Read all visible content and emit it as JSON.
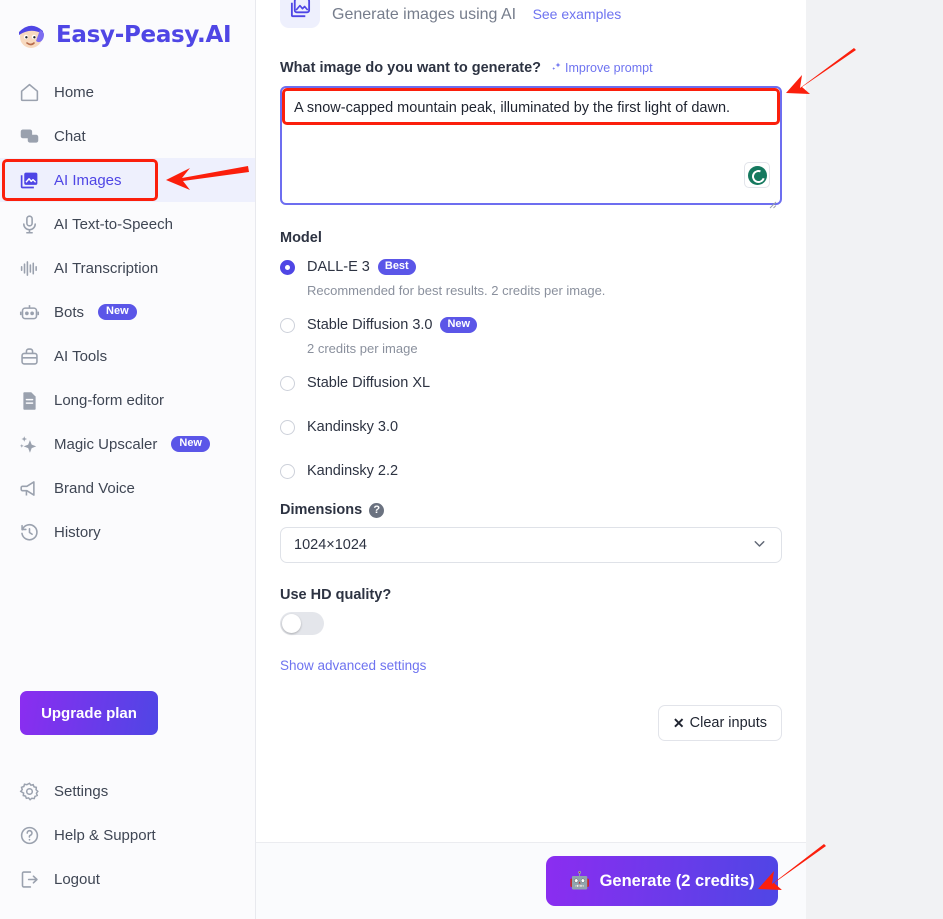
{
  "brand": {
    "name": "Easy-Peasy.AI",
    "mascot_icon": "mascot-avatar-icon"
  },
  "sidebar": {
    "items": [
      {
        "label": "Home",
        "icon": "home-icon",
        "badge": null,
        "active": false
      },
      {
        "label": "Chat",
        "icon": "chat-bubble-icon",
        "badge": null,
        "active": false
      },
      {
        "label": "AI Images",
        "icon": "image-icon",
        "badge": null,
        "active": true
      },
      {
        "label": "AI Text-to-Speech",
        "icon": "microphone-icon",
        "badge": null,
        "active": false
      },
      {
        "label": "AI Transcription",
        "icon": "waveform-icon",
        "badge": null,
        "active": false
      },
      {
        "label": "Bots",
        "icon": "robot-icon",
        "badge": "New",
        "active": false
      },
      {
        "label": "AI Tools",
        "icon": "toolbox-icon",
        "badge": null,
        "active": false
      },
      {
        "label": "Long-form editor",
        "icon": "document-icon",
        "badge": null,
        "active": false
      },
      {
        "label": "Magic Upscaler",
        "icon": "sparkle-icon",
        "badge": "New",
        "active": false
      },
      {
        "label": "Brand Voice",
        "icon": "megaphone-icon",
        "badge": null,
        "active": false
      },
      {
        "label": "History",
        "icon": "history-clock-icon",
        "badge": null,
        "active": false
      }
    ],
    "upgrade_button": "Upgrade plan",
    "bottom_items": [
      {
        "label": "Settings",
        "icon": "gear-icon"
      },
      {
        "label": "Help & Support",
        "icon": "question-circle-icon"
      },
      {
        "label": "Logout",
        "icon": "logout-arrow-icon"
      }
    ]
  },
  "main": {
    "header": {
      "icon": "image-gallery-icon",
      "subtitle": "Generate images using AI",
      "examples_link": "See examples"
    },
    "prompt": {
      "label": "What image do you want to generate?",
      "improve_link": "Improve prompt",
      "improve_icon": "magic-wand-icon",
      "value": "A snow-capped mountain peak, illuminated by the first light of dawn.",
      "placeholder": "",
      "grammarly_icon": "grammarly-icon"
    },
    "model": {
      "label": "Model",
      "options": [
        {
          "name": "DALL-E 3",
          "badge": "Best",
          "hint": "Recommended for best results. 2 credits per image.",
          "selected": true
        },
        {
          "name": "Stable Diffusion 3.0",
          "badge": "New",
          "hint": "2 credits per image",
          "selected": false
        },
        {
          "name": "Stable Diffusion XL",
          "badge": null,
          "hint": null,
          "selected": false
        },
        {
          "name": "Kandinsky 3.0",
          "badge": null,
          "hint": null,
          "selected": false
        },
        {
          "name": "Kandinsky 2.2",
          "badge": null,
          "hint": null,
          "selected": false
        }
      ]
    },
    "dimensions": {
      "label": "Dimensions",
      "help_icon": "question-mark-icon",
      "selected": "1024×1024",
      "chevron_icon": "chevron-down-icon"
    },
    "hd": {
      "label": "Use HD quality?",
      "enabled": false
    },
    "advanced_link": "Show advanced settings",
    "clear_button": {
      "label": "Clear inputs",
      "icon": "close-x-icon"
    },
    "generate_button": {
      "label": "Generate (2 credits)",
      "icon": "robot-face-icon"
    }
  },
  "colors": {
    "accent": "#4f46e5",
    "badge": "#5b56e8",
    "link": "#6e73f0",
    "annotation": "#fb1f0c",
    "panel_bg": "#f1f2f4"
  }
}
